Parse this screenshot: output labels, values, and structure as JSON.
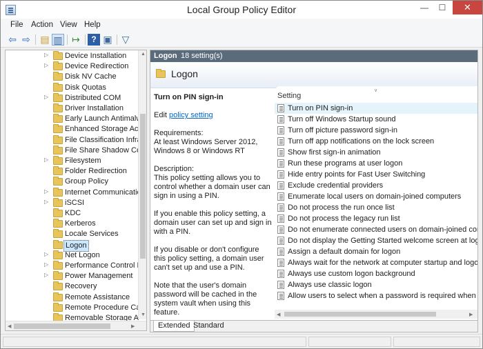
{
  "window": {
    "title": "Local Group Policy Editor",
    "min": "—",
    "max": "☐",
    "close": "✕"
  },
  "menu": [
    "File",
    "Action",
    "View",
    "Help"
  ],
  "tree": {
    "items": [
      {
        "label": "Device Installation",
        "expandable": true
      },
      {
        "label": "Device Redirection",
        "expandable": true
      },
      {
        "label": "Disk NV Cache",
        "expandable": false
      },
      {
        "label": "Disk Quotas",
        "expandable": false
      },
      {
        "label": "Distributed COM",
        "expandable": true
      },
      {
        "label": "Driver Installation",
        "expandable": false
      },
      {
        "label": "Early Launch Antimalw",
        "expandable": false
      },
      {
        "label": "Enhanced Storage Acce",
        "expandable": false
      },
      {
        "label": "File Classification Infras",
        "expandable": false
      },
      {
        "label": "File Share Shadow Copy",
        "expandable": false
      },
      {
        "label": "Filesystem",
        "expandable": true
      },
      {
        "label": "Folder Redirection",
        "expandable": false
      },
      {
        "label": "Group Policy",
        "expandable": false
      },
      {
        "label": "Internet Communicatio",
        "expandable": true
      },
      {
        "label": "iSCSI",
        "expandable": true
      },
      {
        "label": "KDC",
        "expandable": false
      },
      {
        "label": "Kerberos",
        "expandable": false
      },
      {
        "label": "Locale Services",
        "expandable": false
      },
      {
        "label": "Logon",
        "expandable": false,
        "selected": true
      },
      {
        "label": "Net Logon",
        "expandable": true
      },
      {
        "label": "Performance Control P",
        "expandable": true
      },
      {
        "label": "Power Management",
        "expandable": true
      },
      {
        "label": "Recovery",
        "expandable": false
      },
      {
        "label": "Remote Assistance",
        "expandable": false
      },
      {
        "label": "Remote Procedure Call",
        "expandable": false
      },
      {
        "label": "Removable Storage Acc",
        "expandable": false
      }
    ]
  },
  "pane": {
    "header_title": "Logon",
    "header_count": "18 setting(s)",
    "banner_title": "Logon",
    "policy_title": "Turn on PIN sign-in",
    "edit_prefix": "Edit",
    "edit_link": "policy setting",
    "requirements": "Requirements:",
    "requirements_text": "At least Windows Server 2012, Windows 8 or Windows RT",
    "description_label": "Description:",
    "description_text": "This policy setting allows you to control whether a domain user can sign in using a PIN.",
    "enable_text": "If you enable this policy setting, a domain user can set up and sign in with a PIN.",
    "disable_text": "If you disable or don't configure this policy setting, a domain user can't set up and use a PIN.",
    "note_text": "Note that the user's domain password will be cached in the system vault when using this feature.",
    "column_header": "Setting",
    "settings": [
      "Turn on PIN sign-in",
      "Turn off Windows Startup sound",
      "Turn off picture password sign-in",
      "Turn off app notifications on the lock screen",
      "Show first sign-in animation",
      "Run these programs at user logon",
      "Hide entry points for Fast User Switching",
      "Exclude credential providers",
      "Enumerate local users on domain-joined computers",
      "Do not process the run once list",
      "Do not process the legacy run list",
      "Do not enumerate connected users on domain-joined com...",
      "Do not display the Getting Started welcome screen at logon",
      "Assign a default domain for logon",
      "Always wait for the network at computer startup and logon",
      "Always use custom logon background",
      "Always use classic logon",
      "Allow users to select when a password is required when resu..."
    ],
    "tabs": [
      "Extended",
      "Standard"
    ]
  }
}
